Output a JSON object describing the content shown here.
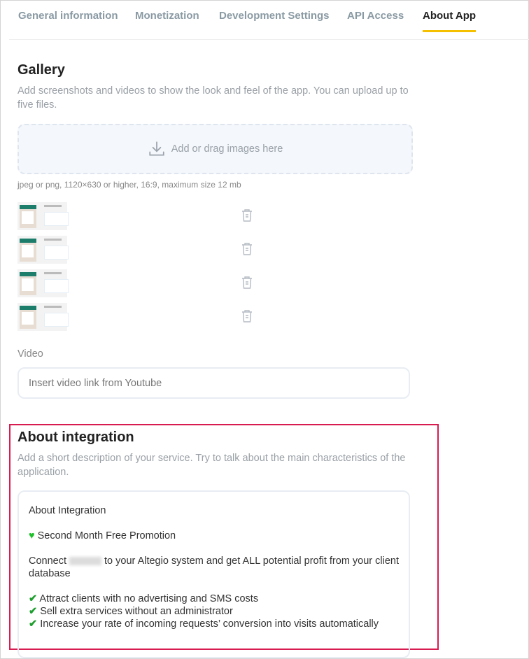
{
  "tabs": [
    {
      "label": "General information",
      "active": false
    },
    {
      "label": "Monetization",
      "active": false
    },
    {
      "label": "Development Settings",
      "active": false
    },
    {
      "label": "API Access",
      "active": false
    },
    {
      "label": "About App",
      "active": true
    }
  ],
  "accent_color": "#f5c000",
  "highlight_color": "#d81b50",
  "gallery": {
    "title": "Gallery",
    "description": "Add screenshots and videos to show the look and feel of the app. You can upload up to five files.",
    "dropzone_label": "Add or drag images here",
    "dropzone_icon": "download-icon",
    "hint": "jpeg or png, 1120×630 or higher, 16:9, maximum size 12 mb",
    "image_count": 4
  },
  "video": {
    "label": "Video",
    "placeholder": "Insert video link from Youtube",
    "value": ""
  },
  "about": {
    "title": "About integration",
    "description": "Add a short description of your service. Try to talk about the main characteristics of the application.",
    "text": {
      "heading": "About Integration",
      "promo": "Second Month Free Promotion",
      "connect_before": "Connect",
      "connect_after": "to your Altegio system and get ALL potential profit from your client database",
      "bullets": [
        "Attract clients with no advertising and SMS costs",
        "Sell extra services without an administrator",
        "Increase your rate of incoming requests’ conversion into visits automatically"
      ]
    }
  }
}
